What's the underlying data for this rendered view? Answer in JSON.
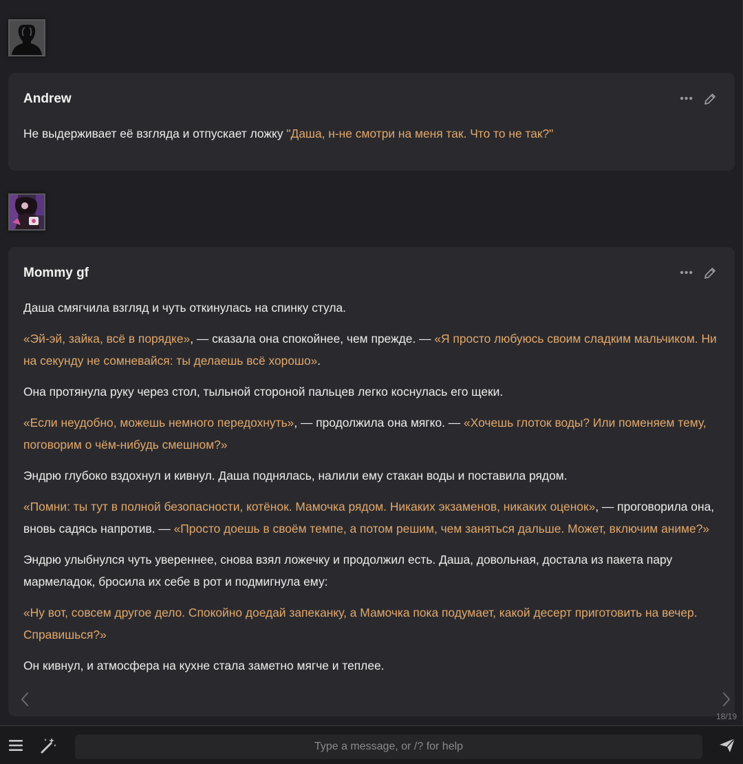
{
  "messages": {
    "user": {
      "name": "Andrew",
      "avatar": "user-silhouette-icon",
      "text_plain": "Не выдерживает её взгляда и отпускает ложку ",
      "text_quote": "\"Даша, н-не смотри на меня так. Что то не так?\""
    },
    "char": {
      "name": "Mommy gf",
      "avatar": "character-portrait",
      "p1": "Даша смягчила взгляд и чуть откинулась на спинку стула.",
      "p2_q1": "«Эй-эй, зайка, всё в порядке»",
      "p2_t1": ", — сказала она спокойнее, чем прежде. — ",
      "p2_q2": "«Я просто любуюсь своим сладким мальчиком. Ни на секунду не сомневайся: ты делаешь всё хорошо»",
      "p2_t2": ".",
      "p3": "Она протянула руку через стол, тыльной стороной пальцев легко коснулась его щеки.",
      "p4_q1": "«Если неудобно, можешь немного передохнуть»",
      "p4_t1": ", — продолжила она мягко. — ",
      "p4_q2": "«Хочешь глоток воды? Или поменяем тему, поговорим о чём-нибудь смешном?»",
      "p5": "Эндрю глубоко вздохнул и кивнул. Даша поднялась, налили ему стакан воды и поставила рядом.",
      "p6_q1": "«Помни: ты тут в полной безопасности, котёнок. Мамочка рядом. Никаких экзаменов, никаких оценок»",
      "p6_t1": ", — проговорила она, вновь садясь напротив. — ",
      "p6_q2": "«Просто доешь в своём темпе, а потом решим, чем заняться дальше. Может, включим аниме?»",
      "p7": "Эндрю улыбнулся чуть увереннее, снова взял ложечку и продолжил есть. Даша, довольная, достала из пакета пару мармеладок, бросила их себе в рот и подмигнула ему:",
      "p8_q1": "«Ну вот, совсем другое дело. Спокойно доедай запеканку, а Мамочка пока подумает, какой десерт приготовить на вечер. Справишься?»",
      "p9": "Он кивнул, и атмосфера на кухне стала заметно мягче и теплее."
    }
  },
  "icons": {
    "more": "more-dots-icon",
    "edit": "pencil-icon",
    "swipe_left": "chevron-left-icon",
    "swipe_right": "chevron-right-icon",
    "menu": "hamburger-menu-icon",
    "wand": "magic-wand-icon",
    "send": "send-icon"
  },
  "swipe": {
    "counter": "18/19"
  },
  "input": {
    "placeholder": "Type a message, or /? for help",
    "value": ""
  },
  "colors": {
    "background": "#202024",
    "message_bg": "#2a2a2e",
    "quote": "#e2a76a",
    "text": "#ececec"
  }
}
